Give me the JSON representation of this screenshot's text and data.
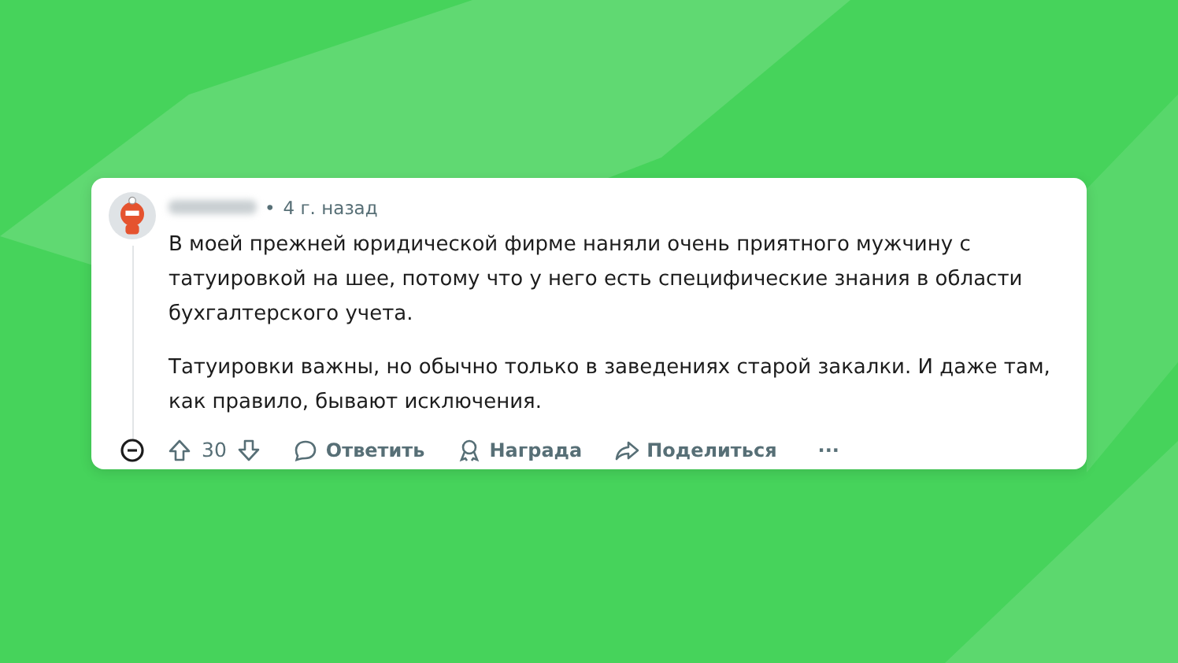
{
  "comment": {
    "time": "4 г. назад",
    "separator": "•",
    "paragraphs": [
      "В моей прежней юридической фирме наняли очень приятного мужчину с татуировкой на шее, потому что у него есть специфические знания в области бухгалтерского учета.",
      "Татуировки важны, но обычно только в заведениях старой закалки. И даже там, как правило, бывают исключения."
    ],
    "score": "30",
    "reply": "Ответить",
    "award": "Награда",
    "share": "Поделиться",
    "more": "···"
  }
}
